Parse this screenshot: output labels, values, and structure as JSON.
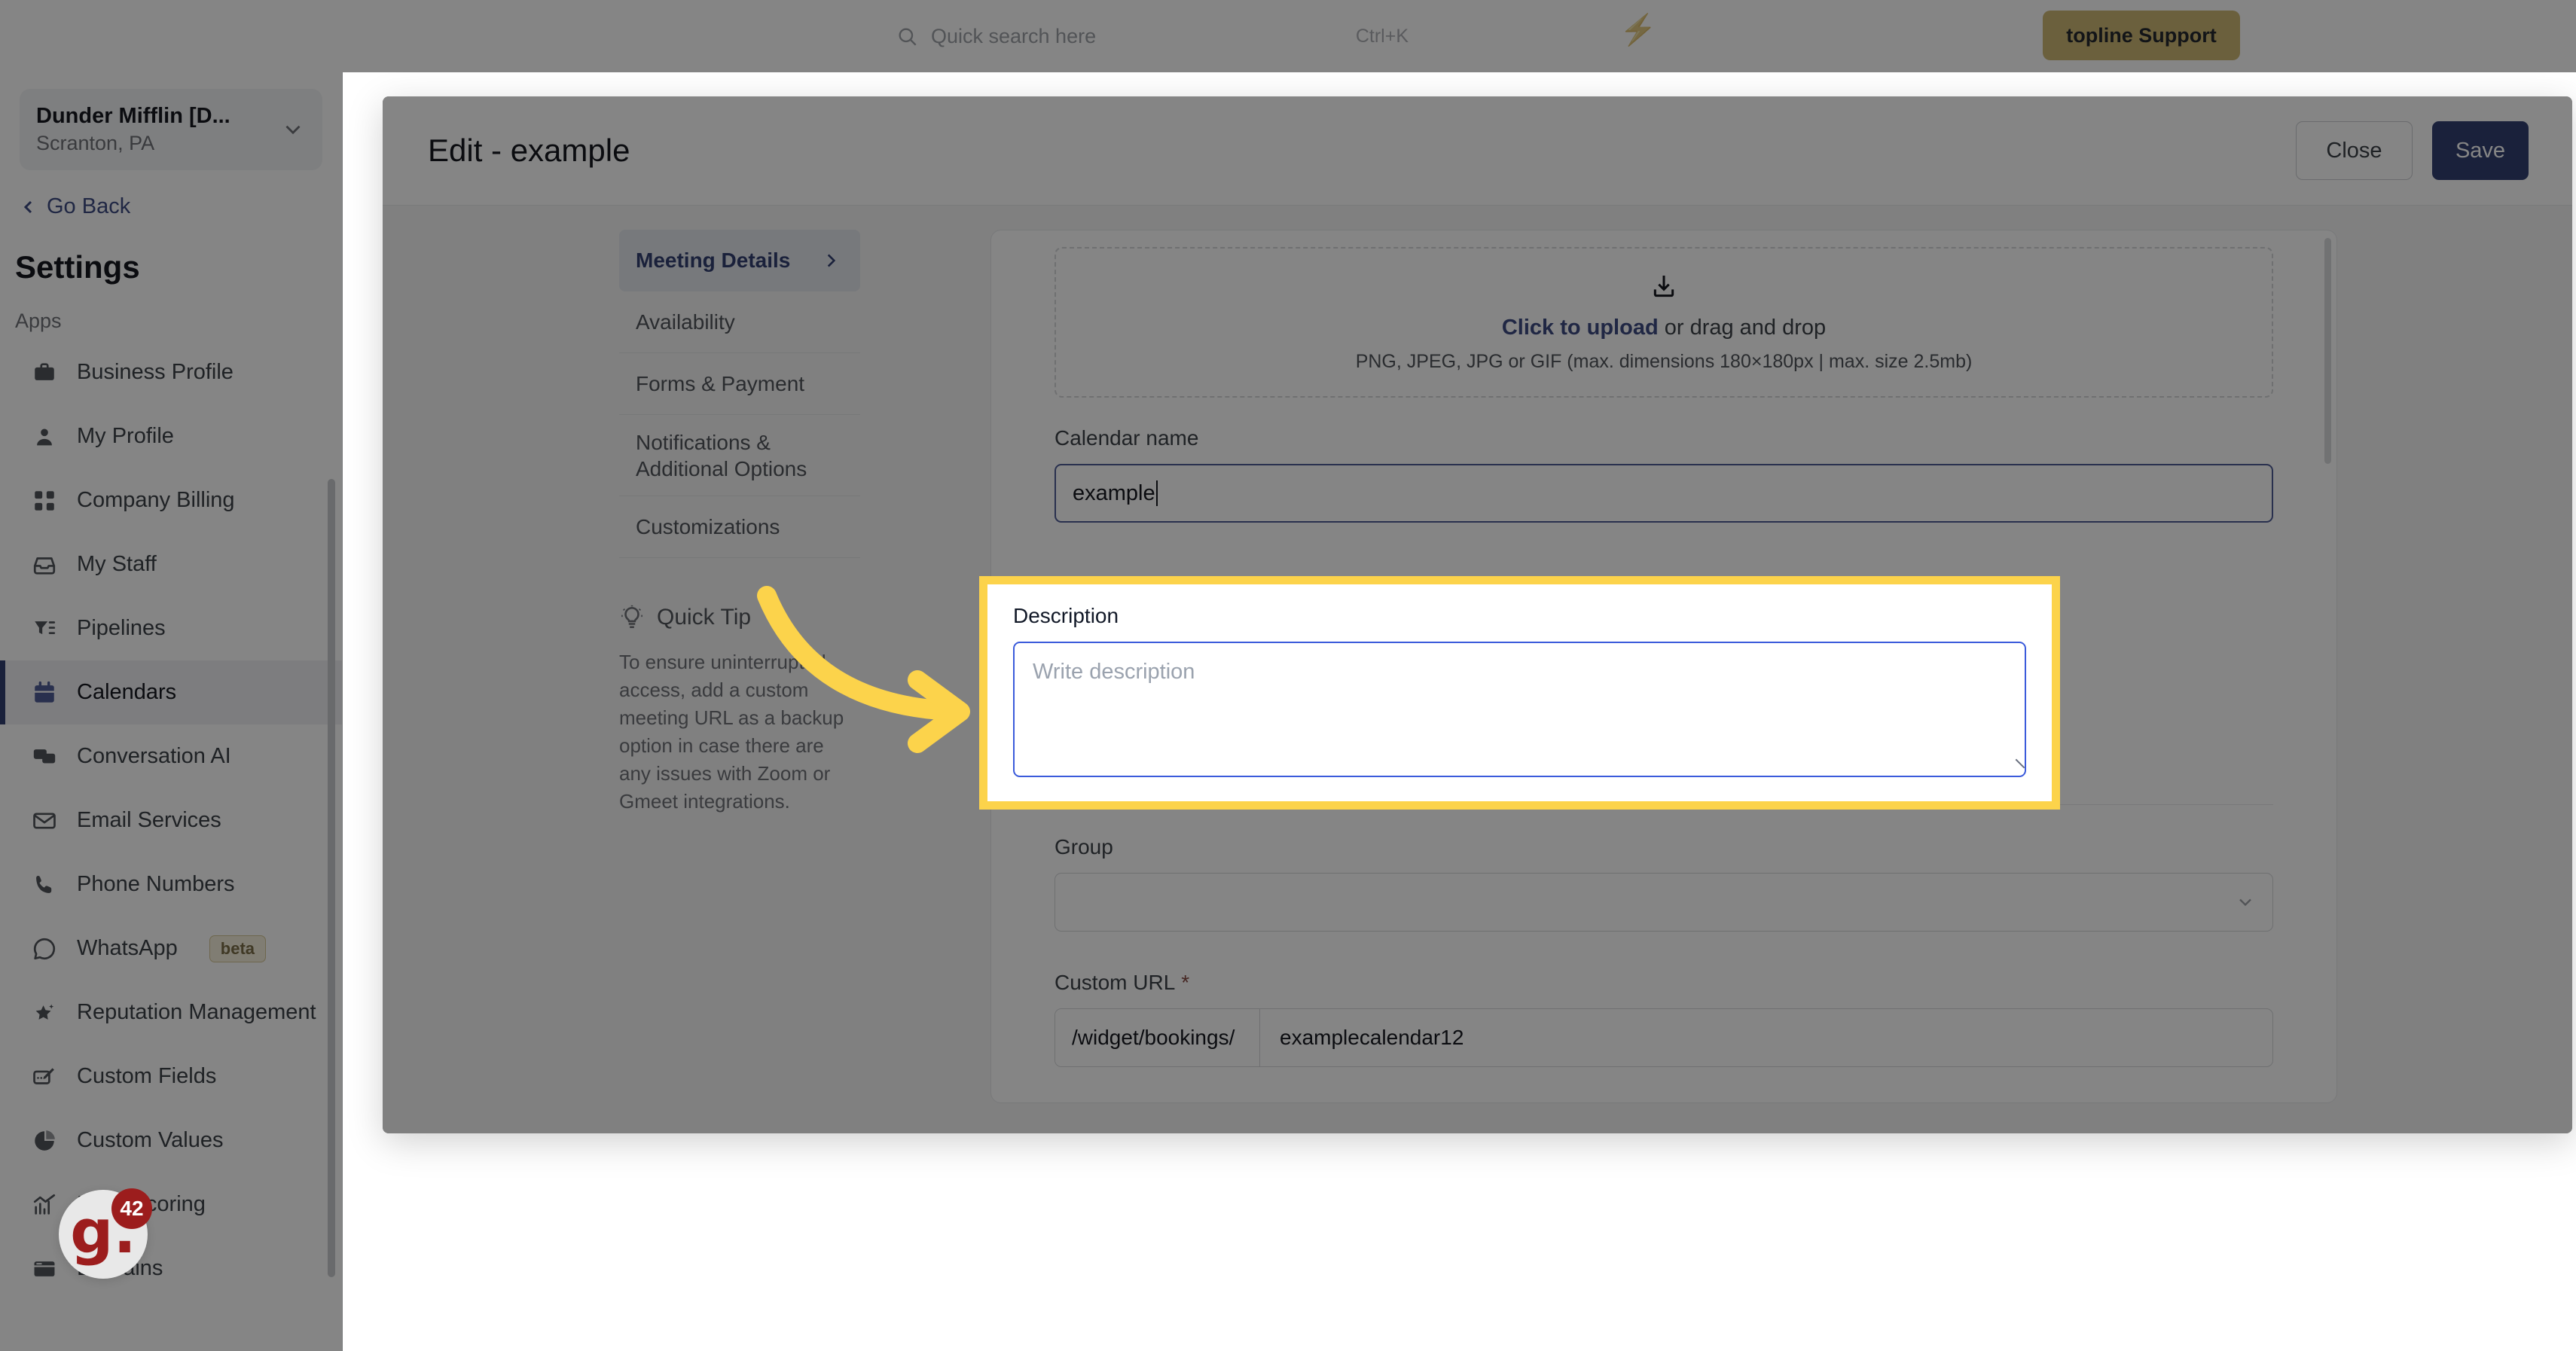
{
  "topbar": {
    "search_placeholder": "Quick search here",
    "search_shortcut": "Ctrl+K",
    "bolt_icon": "lightning-bolt-icon",
    "support_button": "topline Support"
  },
  "sidebar": {
    "org_name": "Dunder Mifflin [D...",
    "org_location": "Scranton, PA",
    "go_back": "Go Back",
    "settings_title": "Settings",
    "section_label": "Apps",
    "items": [
      {
        "label": "Business Profile",
        "icon": "briefcase-icon",
        "active": false,
        "badge": null
      },
      {
        "label": "My Profile",
        "icon": "user-icon",
        "active": false,
        "badge": null
      },
      {
        "label": "Company Billing",
        "icon": "calculator-icon",
        "active": false,
        "badge": null
      },
      {
        "label": "My Staff",
        "icon": "inbox-icon",
        "active": false,
        "badge": null
      },
      {
        "label": "Pipelines",
        "icon": "filter-icon",
        "active": false,
        "badge": null
      },
      {
        "label": "Calendars",
        "icon": "calendar-icon",
        "active": true,
        "badge": null
      },
      {
        "label": "Conversation AI",
        "icon": "chat-bubbles-icon",
        "active": false,
        "badge": null
      },
      {
        "label": "Email Services",
        "icon": "envelope-icon",
        "active": false,
        "badge": null
      },
      {
        "label": "Phone Numbers",
        "icon": "phone-icon",
        "active": false,
        "badge": null
      },
      {
        "label": "WhatsApp",
        "icon": "whatsapp-icon",
        "active": false,
        "badge": "beta"
      },
      {
        "label": "Reputation Management",
        "icon": "star-sparkle-icon",
        "active": false,
        "badge": null
      },
      {
        "label": "Custom Fields",
        "icon": "edit-field-icon",
        "active": false,
        "badge": null
      },
      {
        "label": "Custom Values",
        "icon": "pie-chart-icon",
        "active": false,
        "badge": null
      },
      {
        "label": "Lead Scoring",
        "icon": "bar-chart-icon",
        "active": false,
        "badge": null
      },
      {
        "label": "Domains",
        "icon": "browser-window-icon",
        "active": false,
        "badge": null
      }
    ]
  },
  "modal": {
    "title": "Edit - example",
    "close_label": "Close",
    "save_label": "Save",
    "rail": [
      {
        "label": "Meeting Details",
        "active": true,
        "chevron": "chevron-right-icon"
      },
      {
        "label": "Availability",
        "active": false,
        "chevron": null
      },
      {
        "label": "Forms & Payment",
        "active": false,
        "chevron": null
      },
      {
        "label": "Notifications & Additional Options",
        "active": false,
        "chevron": null
      },
      {
        "label": "Customizations",
        "active": false,
        "chevron": null
      }
    ],
    "quick_tip": {
      "heading": "Quick Tip",
      "icon": "lightbulb-icon",
      "body": "To ensure uninterrupted access, add a custom meeting URL as a backup option in case there are any issues with Zoom or Gmeet integrations."
    },
    "form": {
      "upload": {
        "icon": "upload-tray-icon",
        "link_text": "Click to upload",
        "rest_text": " or drag and drop",
        "hint": "PNG, JPEG, JPG or GIF (max. dimensions 180×180px | max. size 2.5mb)"
      },
      "calendar_name": {
        "label": "Calendar name",
        "value": "example"
      },
      "description": {
        "label": "Description",
        "placeholder": "Write description",
        "value": ""
      },
      "group": {
        "label": "Group",
        "value": "",
        "chevron": "chevron-down-icon"
      },
      "custom_url": {
        "label": "Custom URL",
        "required_marker": "*",
        "prefix": "/widget/bookings/",
        "value": "examplecalendar12"
      }
    }
  },
  "annotations": {
    "arrow": "curved-arrow-right",
    "arrow_color": "#fcd34b",
    "highlight_color": "#fcd34b"
  },
  "chat_widget": {
    "logo": "g.",
    "unread_count": "42"
  },
  "colors": {
    "primary": "#1f3fae",
    "link": "#2a4bc4",
    "accent_yellow": "#fcd34b",
    "support_gold": "#e8b923",
    "chat_red": "#9c1d1d"
  }
}
